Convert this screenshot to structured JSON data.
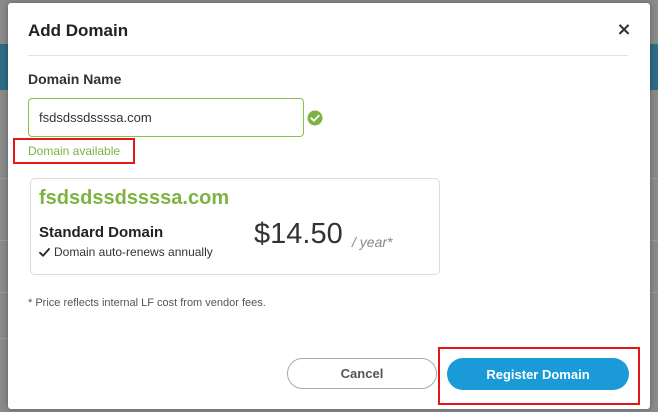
{
  "dialog": {
    "title": "Add Domain",
    "close_label": "×"
  },
  "form": {
    "field_label": "Domain Name",
    "domain_value": "fsdsdssdssssa.com",
    "status_text": "Domain available"
  },
  "result_card": {
    "domain": "fsdsdssdssssa.com",
    "type": "Standard Domain",
    "renew_note": "Domain auto-renews annually",
    "price": "$14.50",
    "per_year": "/ year*"
  },
  "footnote": "* Price reflects internal LF cost from vendor fees.",
  "actions": {
    "cancel_label": "Cancel",
    "register_label": "Register Domain"
  },
  "colors": {
    "accent_green": "#7cb342",
    "primary_blue": "#1a9ad6",
    "highlight_red": "#e01818"
  },
  "icons": {
    "available_check": "check-circle-icon",
    "renew_tick": "checkmark-icon",
    "close": "close-icon"
  }
}
